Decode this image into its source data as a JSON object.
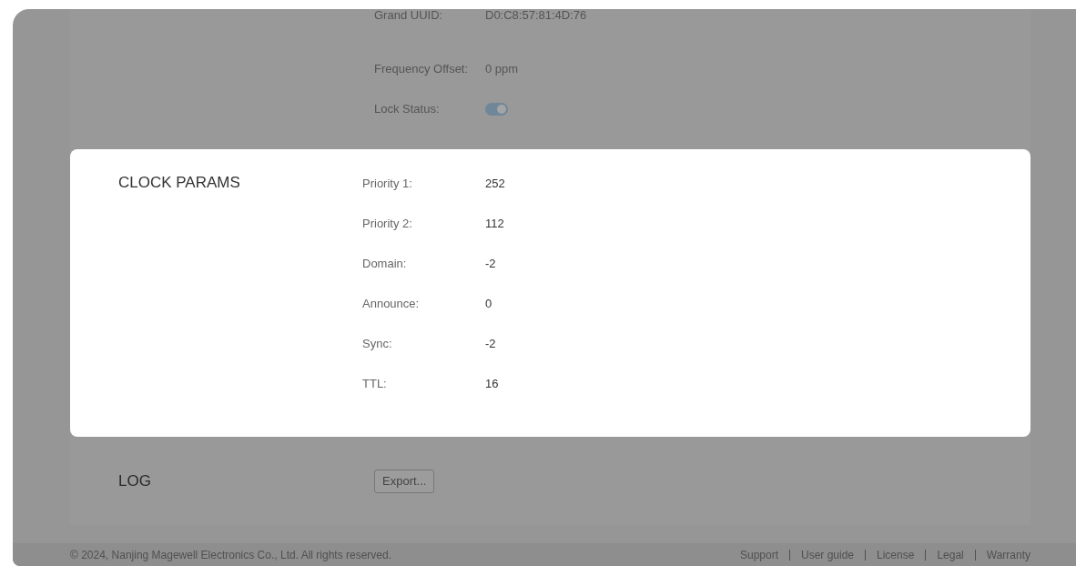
{
  "status_section": {
    "rows": [
      {
        "kind": "text",
        "label": "Grand UUID:",
        "value": "D0:C8:57:81:4D:76"
      },
      {
        "kind": "text",
        "label": "Frequency Offset:",
        "value": "0 ppm"
      },
      {
        "kind": "toggle",
        "label": "Lock Status:",
        "on": true
      }
    ]
  },
  "clock_params": {
    "title": "CLOCK PARAMS",
    "rows": [
      {
        "label": "Priority 1:",
        "value": "252"
      },
      {
        "label": "Priority 2:",
        "value": "112"
      },
      {
        "label": "Domain:",
        "value": "-2"
      },
      {
        "label": "Announce:",
        "value": "0"
      },
      {
        "label": "Sync:",
        "value": "-2"
      },
      {
        "label": "TTL:",
        "value": "16"
      }
    ]
  },
  "log": {
    "title": "LOG",
    "button": "Export..."
  },
  "footer": {
    "copyright": "© 2024, Nanjing Magewell Electronics Co., Ltd. All rights reserved.",
    "links": [
      "Support",
      "User guide",
      "License",
      "Legal",
      "Warranty"
    ]
  }
}
